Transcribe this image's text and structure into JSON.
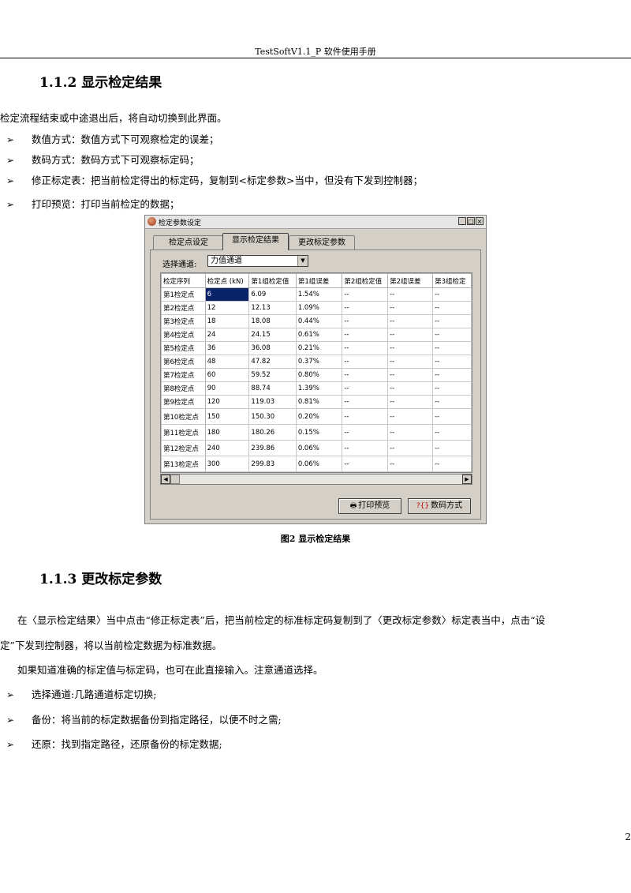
{
  "header": {
    "title": "TestSoftV1.1_P 软件使用手册"
  },
  "sec1": {
    "heading": "1.1.2  显示检定结果",
    "intro": "检定流程结束或中途退出后，将自动切换到此界面。",
    "bullets": [
      "数值方式：数值方式下可观察检定的误差；",
      "数码方式：数码方式下可观察标定码；",
      "修正标定表：把当前检定得出的标定码，复制到<标定参数>当中，但没有下发到控制器；",
      "打印预览：打印当前检定的数据；"
    ]
  },
  "dialog": {
    "title": "检定参数设定",
    "tabs": [
      "检定点设定",
      "显示检定结果",
      "更改标定参数"
    ],
    "channel_label": "选择通道:",
    "channel_value": "力值通道",
    "columns": [
      "检定序列",
      "检定点 (kN)",
      "第1组检定值",
      "第1组误差",
      "第2组检定值",
      "第2组误差",
      "第3组检定"
    ],
    "rows": [
      [
        "第1检定点",
        "6",
        "6.09",
        "1.54%",
        "--",
        "--",
        "--"
      ],
      [
        "第2检定点",
        "12",
        "12.13",
        "1.09%",
        "--",
        "--",
        "--"
      ],
      [
        "第3检定点",
        "18",
        "18.08",
        "0.44%",
        "--",
        "--",
        "--"
      ],
      [
        "第4检定点",
        "24",
        "24.15",
        "0.61%",
        "--",
        "--",
        "--"
      ],
      [
        "第5检定点",
        "36",
        "36.08",
        "0.21%",
        "--",
        "--",
        "--"
      ],
      [
        "第6检定点",
        "48",
        "47.82",
        "0.37%",
        "--",
        "--",
        "--"
      ],
      [
        "第7检定点",
        "60",
        "59.52",
        "0.80%",
        "--",
        "--",
        "--"
      ],
      [
        "第8检定点",
        "90",
        "88.74",
        "1.39%",
        "--",
        "--",
        "--"
      ],
      [
        "第9检定点",
        "120",
        "119.03",
        "0.81%",
        "--",
        "--",
        "--"
      ],
      [
        "第10检定点",
        "150",
        "150.30",
        "0.20%",
        "--",
        "--",
        "--"
      ],
      [
        "第11检定点",
        "180",
        "180.26",
        "0.15%",
        "--",
        "--",
        "--"
      ],
      [
        "第12检定点",
        "240",
        "239.86",
        "0.06%",
        "--",
        "--",
        "--"
      ],
      [
        "第13检定点",
        "300",
        "299.83",
        "0.06%",
        "--",
        "--",
        "--"
      ]
    ],
    "print_button": "打印预览",
    "mode_button": "数码方式",
    "scroll_left": "◀",
    "scroll_right": "▶"
  },
  "figure_caption": "图2  显示检定结果",
  "sec2": {
    "heading": "1.1.3  更改标定参数",
    "para1_line1": "在〈显示检定结果〉当中点击“修正标定表”后，把当前检定的标准标定码复制到了〈更改标定参数〉标定表当中，点击“设",
    "para1_line2": "定”下发到控制器，将以当前检定数据为标准数据。",
    "para2": "如果知道准确的标定值与标定码，也可在此直接输入。注意通道选择。",
    "bullets": [
      "选择通道:几路通道标定切换;",
      "备份：将当前的标定数据备份到指定路径，以便不时之需;",
      "还原：找到指定路径，还原备份的标定数据;"
    ]
  },
  "page_number": "2"
}
